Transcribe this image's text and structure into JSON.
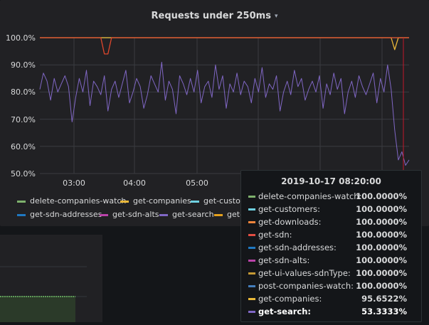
{
  "panel": {
    "title": "Requests under 250ms",
    "caret": "▾"
  },
  "chart_data": {
    "type": "line",
    "title": "Requests under 250ms",
    "y_ticks": [
      "100.0%",
      "90.0%",
      "80.0%",
      "70.0%",
      "60.0%",
      "50.0%"
    ],
    "ylim": [
      50,
      100
    ],
    "x_ticks": [
      "03:00",
      "04:00",
      "05:00"
    ],
    "grid": true,
    "series": [
      {
        "name": "get-search",
        "color": "#8067c5",
        "values": [
          81,
          87,
          84,
          77,
          85,
          80,
          83,
          86,
          82,
          69,
          78,
          85,
          80,
          88,
          75,
          84,
          82,
          79,
          86,
          73,
          81,
          84,
          78,
          83,
          88,
          76,
          80,
          85,
          82,
          74,
          79,
          86,
          83,
          80,
          91,
          77,
          84,
          81,
          72,
          86,
          83,
          79,
          85,
          80,
          88,
          76,
          82,
          84,
          78,
          90,
          81,
          86,
          74,
          83,
          80,
          87,
          79,
          84,
          82,
          76,
          85,
          80,
          89,
          78,
          83,
          81,
          86,
          73,
          80,
          84,
          79,
          88,
          82,
          85,
          77,
          81,
          84,
          80,
          86,
          74,
          83,
          79,
          87,
          81,
          85,
          72,
          80,
          84,
          78,
          86,
          82,
          79,
          83,
          87,
          76,
          85,
          80,
          90,
          81,
          66,
          55,
          58,
          53,
          55
        ]
      },
      {
        "name": "get-sdn",
        "color": "#e0472c",
        "values": [
          100,
          100,
          100,
          100,
          100,
          100,
          100,
          100,
          100,
          100,
          100,
          100,
          100,
          100,
          100,
          100,
          100,
          100,
          94,
          94,
          100,
          100,
          100,
          100,
          100,
          100,
          100,
          100,
          100,
          100,
          100,
          100,
          100,
          100,
          100,
          100,
          100,
          100,
          100,
          100,
          100,
          100,
          100,
          100,
          100,
          100,
          100,
          100,
          100,
          100,
          100,
          100,
          100,
          100,
          100,
          100,
          100,
          100,
          100,
          100,
          100,
          100,
          100,
          100,
          100,
          100,
          100,
          100,
          100,
          100,
          100,
          100,
          100,
          100,
          100,
          100,
          100,
          100,
          100,
          100,
          100,
          100,
          100,
          100,
          100,
          100,
          100,
          100,
          100,
          100,
          100,
          100,
          100,
          100,
          100,
          100,
          100,
          100,
          100,
          100,
          100,
          100,
          100,
          100
        ]
      },
      {
        "name": "get-companies",
        "color": "#eab839",
        "values": [
          100,
          100,
          100,
          100,
          100,
          100,
          100,
          100,
          100,
          100,
          100,
          100,
          100,
          100,
          100,
          100,
          100,
          100,
          100,
          100,
          100,
          100,
          100,
          100,
          100,
          100,
          100,
          100,
          100,
          100,
          100,
          100,
          100,
          100,
          100,
          100,
          100,
          100,
          100,
          100,
          100,
          100,
          100,
          100,
          100,
          100,
          100,
          100,
          100,
          100,
          100,
          100,
          100,
          100,
          100,
          100,
          100,
          100,
          100,
          100,
          100,
          100,
          100,
          100,
          100,
          100,
          100,
          100,
          100,
          100,
          100,
          100,
          100,
          100,
          100,
          100,
          100,
          100,
          100,
          100,
          100,
          100,
          100,
          100,
          100,
          100,
          100,
          100,
          100,
          100,
          100,
          100,
          100,
          100,
          100,
          100,
          100,
          100,
          100,
          95.6,
          100,
          100,
          100,
          100
        ]
      },
      {
        "name": "delete-companies-watch",
        "color": "#7eb26d",
        "values": [
          100,
          100,
          100,
          100,
          100,
          100,
          100,
          100,
          100,
          100,
          100,
          100,
          100,
          100,
          100,
          100,
          100,
          100,
          100,
          100,
          100,
          100,
          100,
          100,
          100,
          100,
          100,
          100,
          100,
          100,
          100,
          100,
          100,
          100,
          100,
          100,
          100,
          100,
          100,
          100,
          100,
          100,
          100,
          100,
          100,
          100,
          100,
          100,
          100,
          100,
          100,
          100,
          100,
          100,
          100,
          100,
          100,
          100,
          100,
          100,
          100,
          100,
          100,
          100,
          100,
          100,
          100,
          100,
          100,
          100,
          100,
          100,
          100,
          100,
          100,
          100,
          100,
          100,
          100,
          100,
          100,
          100,
          100,
          100,
          100,
          100,
          100,
          100,
          100,
          100,
          100,
          100,
          100,
          100,
          100,
          100,
          100,
          100,
          100,
          100,
          100,
          100,
          100,
          100
        ]
      }
    ]
  },
  "legend": [
    {
      "name": "delete-companies-watch",
      "color": "#7eb26d"
    },
    {
      "name": "get-companies",
      "color": "#eab839"
    },
    {
      "name": "get-custom",
      "color": "#6ed0e0"
    },
    {
      "name": "get-sdn-addresses",
      "color": "#1f78c1"
    },
    {
      "name": "get-sdn-alts",
      "color": "#ba43a9"
    },
    {
      "name": "get-search",
      "color": "#8067c5"
    },
    {
      "name": "get-",
      "color": "#e5a11c"
    }
  ],
  "tooltip": {
    "time": "2019-10-17 08:20:00",
    "rows": [
      {
        "name": "delete-companies-watch:",
        "value": "100.0000%",
        "color": "#7eb26d"
      },
      {
        "name": "get-customers:",
        "value": "100.0000%",
        "color": "#6ed0e0"
      },
      {
        "name": "get-downloads:",
        "value": "100.0000%",
        "color": "#ef843c"
      },
      {
        "name": "get-sdn:",
        "value": "100.0000%",
        "color": "#e24d42"
      },
      {
        "name": "get-sdn-addresses:",
        "value": "100.0000%",
        "color": "#1f78c1"
      },
      {
        "name": "get-sdn-alts:",
        "value": "100.0000%",
        "color": "#ba43a9"
      },
      {
        "name": "get-ui-values-sdnType:",
        "value": "100.0000%",
        "color": "#c59934"
      },
      {
        "name": "post-companies-watch:",
        "value": "100.0000%",
        "color": "#447ebc"
      },
      {
        "name": "get-companies:",
        "value": "95.6522%",
        "color": "#eab839"
      },
      {
        "name": "get-search:",
        "value": "53.3333%",
        "color": "#8067c5"
      }
    ]
  },
  "mini_panel": {
    "series_color": "#73bf69"
  }
}
